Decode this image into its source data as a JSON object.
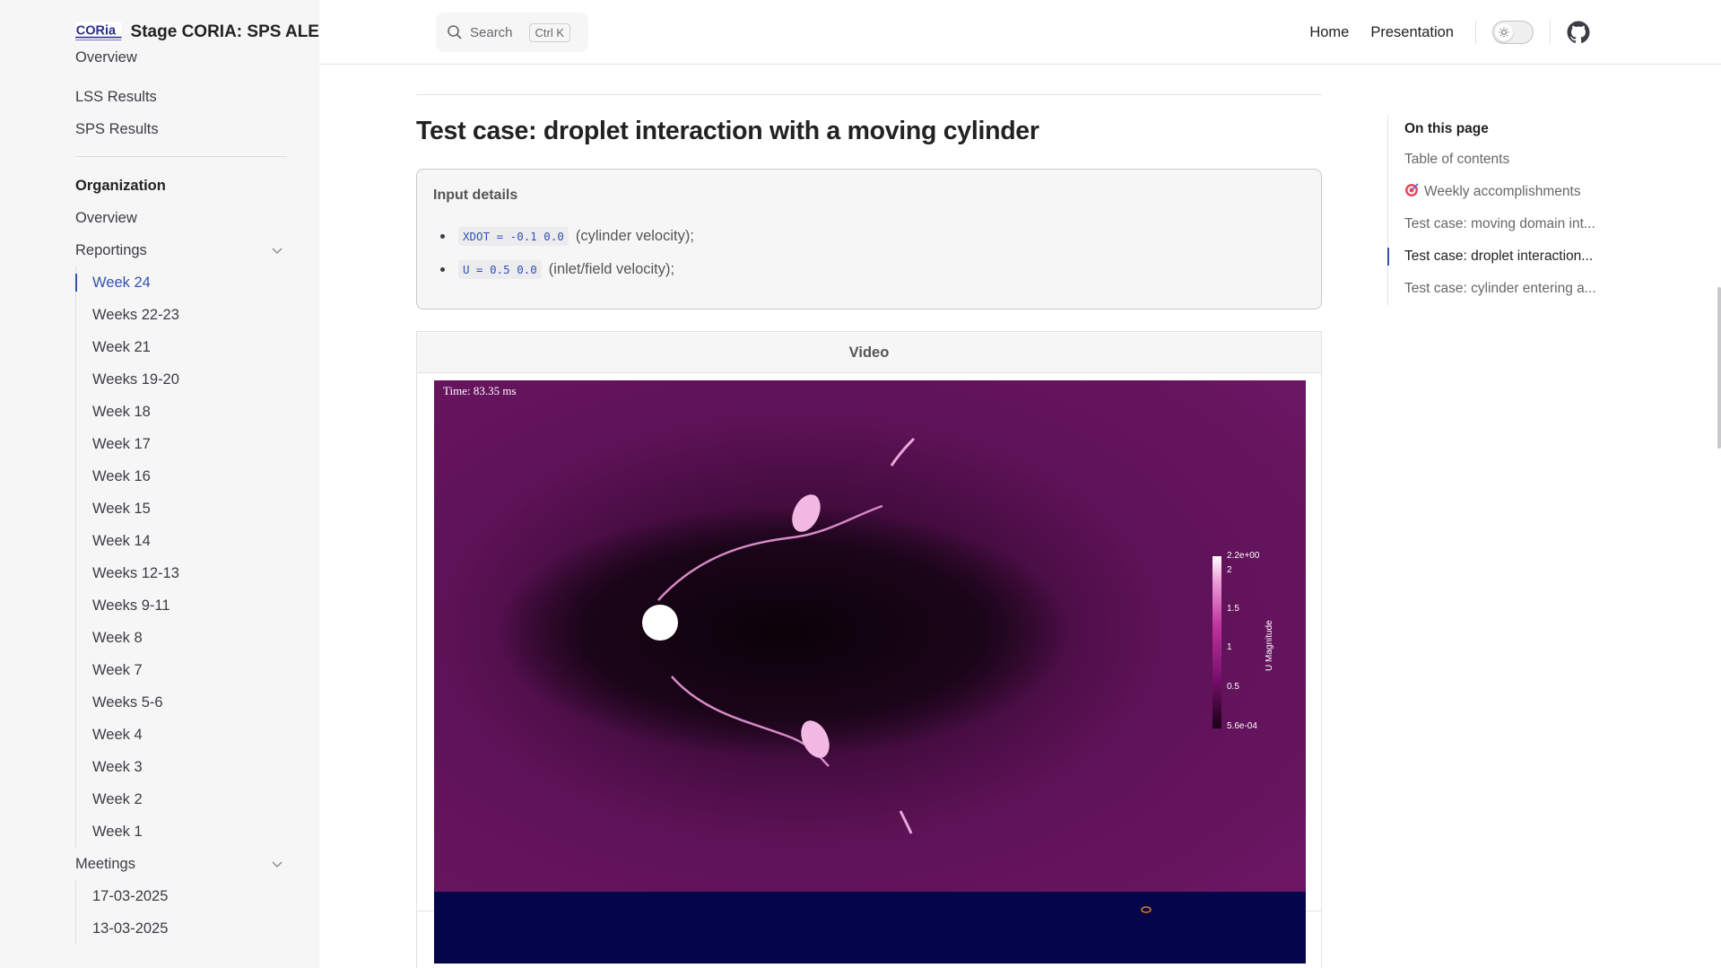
{
  "brand": {
    "title": "Stage CORIA: SPS ALE",
    "logo_text": "CORia"
  },
  "search": {
    "label": "Search",
    "shortcut": "Ctrl K"
  },
  "nav": {
    "home": "Home",
    "presentation": "Presentation",
    "theme_toggle_icon": "sun-icon",
    "repo_icon": "github-icon"
  },
  "sidebar": {
    "partial_item": "Overview",
    "results": [
      "LSS Results",
      "SPS Results"
    ],
    "organization": {
      "heading": "Organization",
      "overview": "Overview",
      "reportings": {
        "label": "Reportings",
        "items": [
          "Week 24",
          "Weeks 22-23",
          "Week 21",
          "Weeks 19-20",
          "Week 18",
          "Week 17",
          "Week 16",
          "Week 15",
          "Week 14",
          "Weeks 12-13",
          "Weeks 9-11",
          "Week 8",
          "Week 7",
          "Weeks 5-6",
          "Week 4",
          "Week 3",
          "Week 2",
          "Week 1"
        ],
        "active": "Week 24"
      },
      "meetings": {
        "label": "Meetings",
        "items": [
          "17-03-2025",
          "13-03-2025"
        ]
      }
    }
  },
  "main": {
    "heading": "Test case: droplet interaction with a moving cylinder",
    "details": {
      "title": "Input details",
      "items": [
        {
          "code": "XDOT = -0.1 0.0",
          "text": "(cylinder velocity);"
        },
        {
          "code": "U = 0.5 0.0",
          "text": "(inlet/field velocity);"
        }
      ]
    },
    "table": {
      "header": "Video",
      "video": {
        "time_label": "Time: 83.35 ms",
        "colorbar_title": "U Magnitude",
        "colorbar_ticks": [
          "2.2e+00",
          "2",
          "1.5",
          "1",
          "0.5",
          "5.6e-04"
        ]
      }
    }
  },
  "aside": {
    "title": "On this page",
    "items": [
      "Table of contents",
      "Weekly accomplishments",
      "Test case: moving domain int...",
      "Test case: droplet interaction...",
      "Test case: cylinder entering a..."
    ],
    "active_index": 3
  },
  "colors": {
    "accent": "#3451b2",
    "sidebar_bg": "#f6f6f7",
    "plot_bg": "#6a1460",
    "video2_bg": "#05054a"
  }
}
